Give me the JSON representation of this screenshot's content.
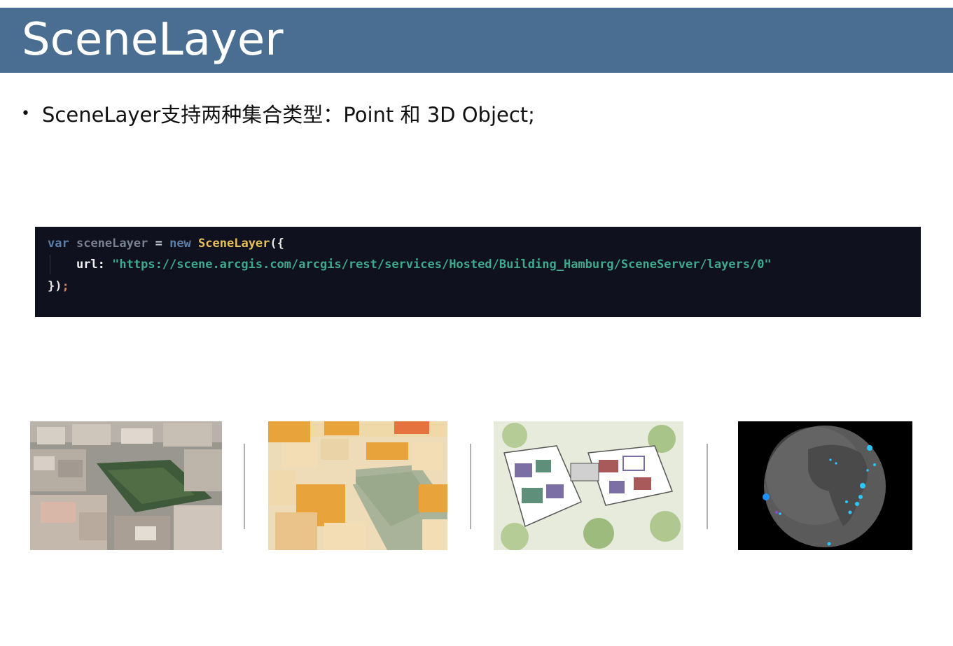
{
  "slide": {
    "title": "SceneLayer",
    "bullet_symbol": "•",
    "bullet_text": "SceneLayer支持两种集合类型：Point 和 3D Object;"
  },
  "code": {
    "kw_var": "var",
    "var_name": "sceneLayer",
    "op_eq": "=",
    "kw_new": "new",
    "class_name": "SceneLayer",
    "open_paren": "({",
    "prop": "url:",
    "url": "\"https://scene.arcgis.com/arcgis/rest/services/Hosted/Building_Hamburg/SceneServer/layers/0\"",
    "close": "})",
    "semicolon": ";"
  },
  "images": [
    {
      "name": "city-photo-mesh",
      "icon": "city-photo-icon"
    },
    {
      "name": "city-3d-buildings",
      "icon": "buildings-icon"
    },
    {
      "name": "building-floorplan-3d",
      "icon": "floorplan-icon"
    },
    {
      "name": "globe-points",
      "icon": "globe-icon"
    }
  ]
}
